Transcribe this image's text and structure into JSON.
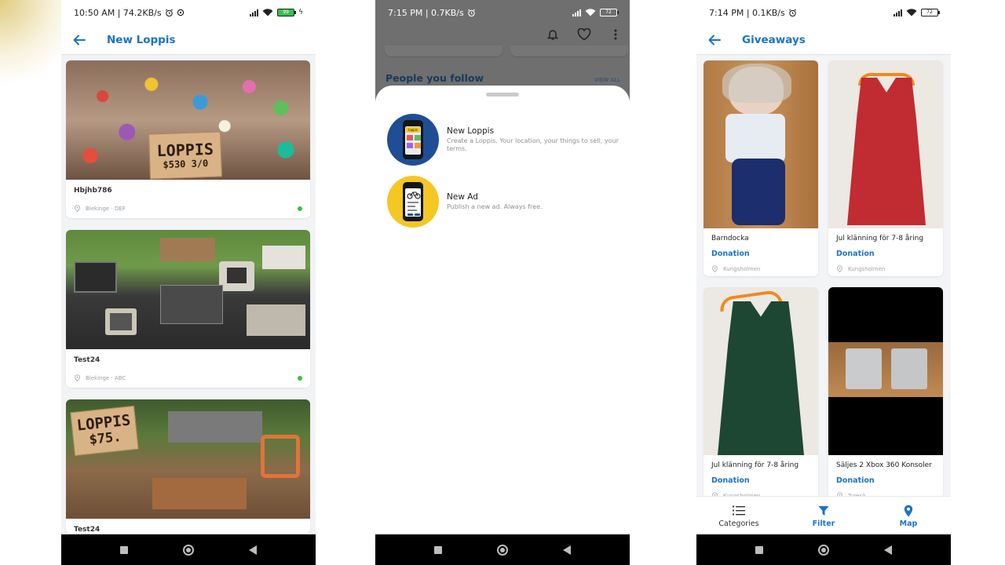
{
  "screens": {
    "new_loppis": {
      "status": {
        "time_speed": "10:50 AM | 74.2KB/s",
        "battery": "99"
      },
      "title": "New Loppis",
      "cards": [
        {
          "title": "Hbjhb786",
          "location": "Blekinge · DEF",
          "sign_line1": "LOPPIS",
          "sign_line2": "$530 3/0"
        },
        {
          "title": "Test24",
          "location": "Blekinge · ABC"
        },
        {
          "title": "Test24",
          "sign_line1": "LOPPIS",
          "sign_line2": "$75."
        }
      ]
    },
    "create_sheet": {
      "status": {
        "time_speed": "7:15 PM | 0.7KB/s",
        "battery": "72"
      },
      "background_section": {
        "heading": "People you follow",
        "view_all": "VIEW ALL"
      },
      "items": [
        {
          "title": "New Loppis",
          "description": "Create a Loppis. Your location, your things to sell, your terms.",
          "icon_text": "loppis"
        },
        {
          "title": "New Ad",
          "description": "Publish a new ad. Always free."
        }
      ]
    },
    "giveaways": {
      "status": {
        "time_speed": "7:14 PM | 0.1KB/s",
        "battery": "72"
      },
      "title": "Giveaways",
      "items": [
        {
          "title": "Barndocka",
          "category": "Donation",
          "location": "Kungsholmen"
        },
        {
          "title": "Jul klänning för 7-8 åring",
          "category": "Donation",
          "location": "Kungsholmen"
        },
        {
          "title": "Jul klänning för 7-8 åring",
          "category": "Donation",
          "location": "Kungsholmen"
        },
        {
          "title": "Säljes 2 Xbox 360 Konsoler",
          "category": "Donation",
          "location": "Tyresö"
        }
      ],
      "tabs": [
        {
          "label": "Categories",
          "icon": "list-icon"
        },
        {
          "label": "Filter",
          "icon": "filter-icon",
          "active": true
        },
        {
          "label": "Map",
          "icon": "map-pin-icon"
        }
      ]
    }
  },
  "colors": {
    "accent": "#1a73c6",
    "online": "#3cc13b",
    "sheet_icon_blue": "#1f4e96",
    "sheet_icon_yellow": "#f5c723"
  }
}
